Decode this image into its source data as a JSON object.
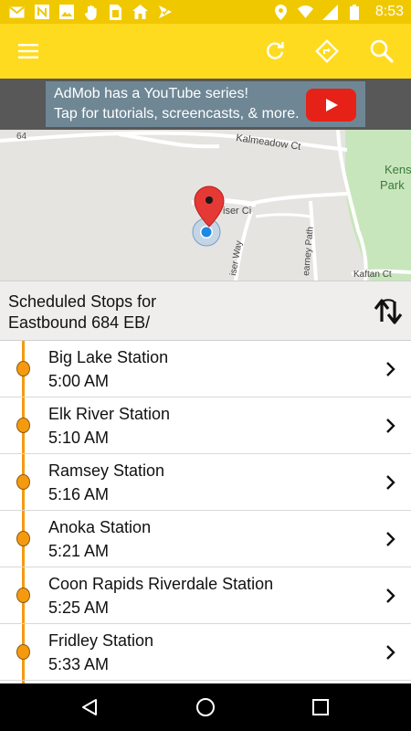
{
  "status_bar": {
    "time": "8:53",
    "left_icons": [
      "gmail-icon",
      "news-icon",
      "photos-icon",
      "hand-icon",
      "sim-icon",
      "home-icon",
      "nav-check-icon"
    ],
    "right_icons": [
      "location-icon",
      "wifi-icon",
      "signal-icon",
      "battery-icon"
    ]
  },
  "app_bar": {
    "color": "#FFDB1F",
    "actions": [
      "menu-icon",
      "refresh-icon",
      "directions-icon",
      "search-icon"
    ]
  },
  "ad": {
    "line1": "AdMob has a YouTube series!",
    "line2": "Tap for tutorials, screencasts, & more."
  },
  "map": {
    "labels": {
      "road_64": "64",
      "kalmeadow": "Kalmeadow Ct",
      "kensington1": "Kensingt",
      "kensington2": "Park",
      "iser": "iser Ci",
      "iser_way": "iser Way",
      "kearney": "earney Path",
      "kaftan": "Kaftan Ct"
    }
  },
  "header": {
    "line1": "Scheduled Stops for",
    "line2": "Eastbound 684 EB/"
  },
  "stops": [
    {
      "name": "Big Lake Station",
      "time": "5:00 AM"
    },
    {
      "name": "Elk River Station",
      "time": "5:10 AM"
    },
    {
      "name": "Ramsey Station",
      "time": "5:16 AM"
    },
    {
      "name": "Anoka Station",
      "time": "5:21 AM"
    },
    {
      "name": "Coon Rapids Riverdale Station",
      "time": "5:25 AM"
    },
    {
      "name": "Fridley Station",
      "time": "5:33 AM"
    }
  ],
  "colors": {
    "status_bar": "#F0C800",
    "route_line": "#F59A0F",
    "marker": "#E53935",
    "location_dot": "#1E88E5"
  }
}
